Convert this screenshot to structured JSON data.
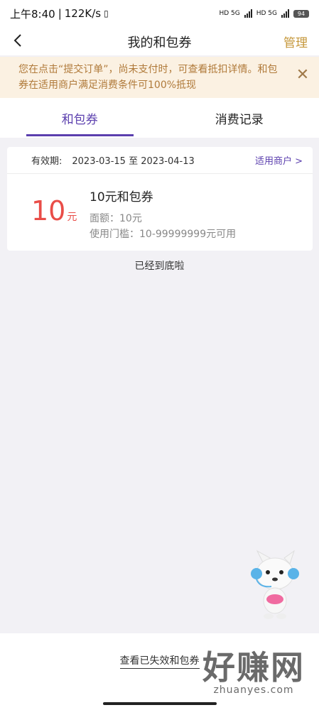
{
  "status_bar": {
    "time": "上午8:40",
    "speed": "122K/s",
    "network_1": "HD 5G",
    "network_2": "HD 5G",
    "battery": "94"
  },
  "nav": {
    "title": "我的和包券",
    "manage_label": "管理"
  },
  "notice": {
    "text": "您在点击“提交订单”，尚未支付时，可查看抵扣详情。和包券在适用商户满足消费条件可100%抵现"
  },
  "tabs": [
    {
      "label": "和包券",
      "active": true
    },
    {
      "label": "消费记录",
      "active": false
    }
  ],
  "coupons": [
    {
      "validity_label": "有效期:",
      "validity": "2023-03-15 至 2023-04-13",
      "merchant_link": "适用商户 >",
      "amount": "10",
      "amount_unit": "元",
      "name": "10元和包券",
      "face_value": "面额：10元",
      "threshold": "使用门槛：10-99999999元可用"
    }
  ],
  "list_end_text": "已经到底啦",
  "footer": {
    "invalid_link": "查看已失效和包券",
    "watermark_main": "好赚网",
    "watermark_sub": "zhuanyes.com"
  },
  "colors": {
    "accent": "#5b3fae",
    "manage": "#c5973a",
    "amount": "#e94d48",
    "notice_bg": "#fbf1e2",
    "notice_text": "#b07a3a"
  }
}
